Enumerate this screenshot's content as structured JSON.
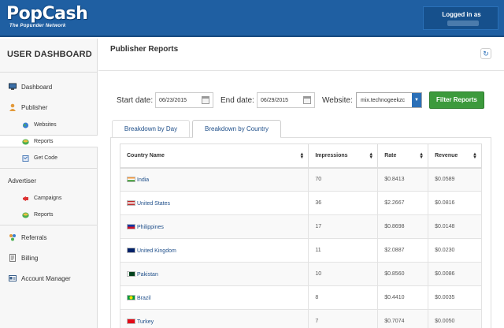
{
  "header": {
    "logo_text": "PopCash",
    "logo_tagline": "The Popunder Network",
    "logged_in_label": "Logged in as"
  },
  "sidebar": {
    "title": "USER DASHBOARD",
    "dashboard": "Dashboard",
    "publisher": "Publisher",
    "publisher_items": [
      "Websites",
      "Reports",
      "Get Code"
    ],
    "advertiser": "Advertiser",
    "advertiser_items": [
      "Campaigns",
      "Reports"
    ],
    "referrals": "Referrals",
    "billing": "Billing",
    "account_manager": "Account Manager"
  },
  "main": {
    "title": "Publisher Reports",
    "start_label": "Start date:",
    "start_value": "06/23/2015",
    "end_label": "End date:",
    "end_value": "06/29/2015",
    "website_label": "Website:",
    "website_value": "mix.technogeekzc",
    "filter_button": "Filter Reports",
    "tabs": [
      "Breakdown by Day",
      "Breakdown by Country"
    ]
  },
  "table": {
    "columns": [
      "Country Name",
      "Impressions",
      "Rate",
      "Revenue"
    ],
    "rows": [
      {
        "country": "India",
        "impressions": "70",
        "rate": "$0.8413",
        "revenue": "$0.0589"
      },
      {
        "country": "United States",
        "impressions": "36",
        "rate": "$2.2667",
        "revenue": "$0.0816"
      },
      {
        "country": "Philippines",
        "impressions": "17",
        "rate": "$0.8698",
        "revenue": "$0.0148"
      },
      {
        "country": "United Kingdom",
        "impressions": "11",
        "rate": "$2.0887",
        "revenue": "$0.0230"
      },
      {
        "country": "Pakistan",
        "impressions": "10",
        "rate": "$0.8560",
        "revenue": "$0.0086"
      },
      {
        "country": "Brazil",
        "impressions": "8",
        "rate": "$0.4410",
        "revenue": "$0.0035"
      },
      {
        "country": "Turkey",
        "impressions": "7",
        "rate": "$0.7074",
        "revenue": "$0.0050"
      }
    ]
  },
  "colors": {
    "header": "#1f5fa2",
    "button": "#3c9a3c",
    "link": "#1f4f8a"
  }
}
